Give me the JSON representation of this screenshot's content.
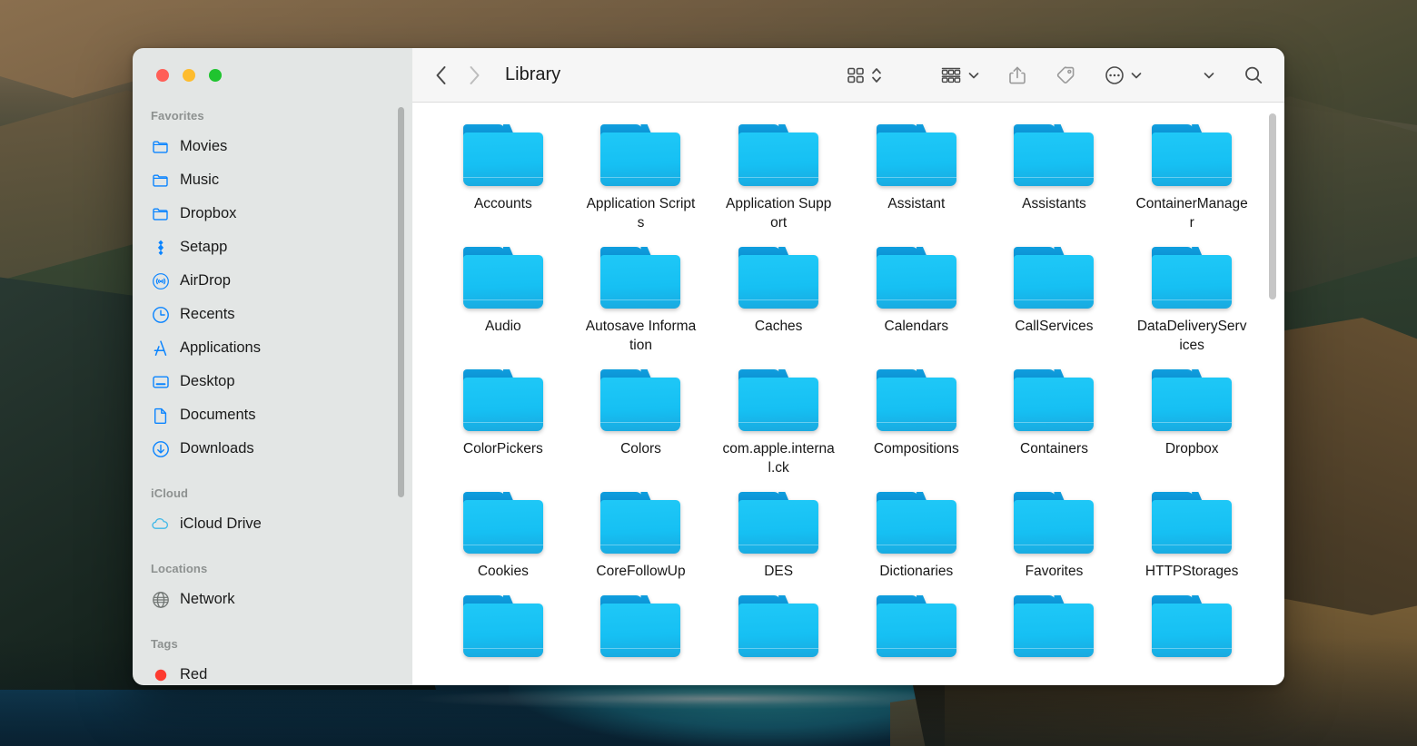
{
  "window": {
    "title": "Library",
    "traffic_lights": [
      {
        "name": "close",
        "color": "#ff5f57"
      },
      {
        "name": "minimize",
        "color": "#febc2e"
      },
      {
        "name": "zoom",
        "color": "#1fc42f"
      }
    ]
  },
  "toolbar": {
    "back_label": "‹",
    "forward_label": "›",
    "icons": [
      {
        "name": "icon-view-button",
        "label": "icon-view-icon"
      },
      {
        "name": "view-stepper",
        "label": "chevron-updown-icon"
      },
      {
        "name": "group-by-button",
        "label": "group-by-icon"
      },
      {
        "name": "group-by-chevron",
        "label": "chevron-down-icon"
      },
      {
        "name": "share-button",
        "label": "share-icon"
      },
      {
        "name": "tag-button",
        "label": "tag-icon"
      },
      {
        "name": "more-button",
        "label": "ellipsis-circle-icon"
      },
      {
        "name": "more-chevron",
        "label": "chevron-down-icon"
      },
      {
        "name": "overflow-chevron",
        "label": "chevron-down-icon"
      },
      {
        "name": "search-button",
        "label": "search-icon"
      }
    ]
  },
  "sidebar": {
    "sections": [
      {
        "title": "Favorites",
        "items": [
          {
            "label": "Movies",
            "icon": "folder-icon"
          },
          {
            "label": "Music",
            "icon": "folder-icon"
          },
          {
            "label": "Dropbox",
            "icon": "folder-icon"
          },
          {
            "label": "Setapp",
            "icon": "setapp-icon"
          },
          {
            "label": "AirDrop",
            "icon": "airdrop-icon"
          },
          {
            "label": "Recents",
            "icon": "clock-icon"
          },
          {
            "label": "Applications",
            "icon": "applications-icon"
          },
          {
            "label": "Desktop",
            "icon": "desktop-icon"
          },
          {
            "label": "Documents",
            "icon": "document-icon"
          },
          {
            "label": "Downloads",
            "icon": "download-icon"
          }
        ]
      },
      {
        "title": "iCloud",
        "items": [
          {
            "label": "iCloud Drive",
            "icon": "cloud-icon"
          }
        ]
      },
      {
        "title": "Locations",
        "items": [
          {
            "label": "Network",
            "icon": "globe-icon"
          }
        ]
      },
      {
        "title": "Tags",
        "items": [
          {
            "label": "Red",
            "icon": "red-dot-icon"
          }
        ]
      }
    ]
  },
  "main": {
    "files": [
      {
        "name": "Accounts",
        "type": "folder"
      },
      {
        "name": "Application Scripts",
        "type": "folder"
      },
      {
        "name": "Application Support",
        "type": "folder"
      },
      {
        "name": "Assistant",
        "type": "folder"
      },
      {
        "name": "Assistants",
        "type": "folder"
      },
      {
        "name": "ContainerManager",
        "type": "folder"
      },
      {
        "name": "Audio",
        "type": "folder"
      },
      {
        "name": "Autosave Information",
        "type": "folder"
      },
      {
        "name": "Caches",
        "type": "folder"
      },
      {
        "name": "Calendars",
        "type": "folder"
      },
      {
        "name": "CallServices",
        "type": "folder"
      },
      {
        "name": "DataDeliveryServices",
        "type": "folder"
      },
      {
        "name": "ColorPickers",
        "type": "folder"
      },
      {
        "name": "Colors",
        "type": "folder"
      },
      {
        "name": "com.apple.internal.ck",
        "type": "folder"
      },
      {
        "name": "Compositions",
        "type": "folder"
      },
      {
        "name": "Containers",
        "type": "folder"
      },
      {
        "name": "Dropbox",
        "type": "folder"
      },
      {
        "name": "Cookies",
        "type": "folder"
      },
      {
        "name": "CoreFollowUp",
        "type": "folder"
      },
      {
        "name": "DES",
        "type": "folder"
      },
      {
        "name": "Dictionaries",
        "type": "folder"
      },
      {
        "name": "Favorites",
        "type": "folder"
      },
      {
        "name": "HTTPStorages",
        "type": "folder"
      },
      {
        "name": "",
        "type": "folder"
      },
      {
        "name": "",
        "type": "folder"
      },
      {
        "name": "",
        "type": "folder"
      },
      {
        "name": "",
        "type": "folder"
      },
      {
        "name": "",
        "type": "folder"
      },
      {
        "name": "",
        "type": "folder"
      }
    ]
  },
  "colors": {
    "folder_blue": "#16c0f3",
    "folder_tab": "#0b8fd0",
    "sidebar_bg": "#e3e6e5",
    "toolbar_bg": "#f6f6f6",
    "accent": "#0a84ff"
  }
}
